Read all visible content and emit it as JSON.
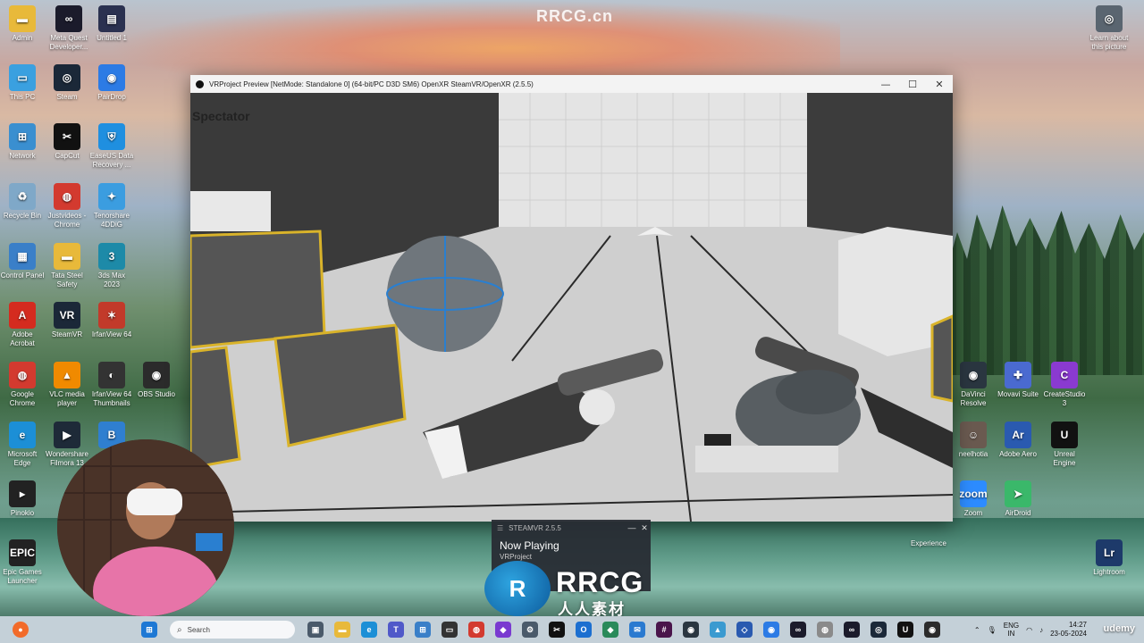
{
  "watermark": {
    "top": "RRCG.cn",
    "logo_big": "RRCG",
    "logo_small": "人人素材",
    "logo_mark": "R",
    "corner": "udemy"
  },
  "desktop_icons_left": [
    {
      "label": "Admin",
      "icon": "folder-icon",
      "color": "#e8b93a",
      "glyph": "▬"
    },
    {
      "label": "Meta Quest Developer...",
      "icon": "meta-icon",
      "color": "#1b1b2b",
      "glyph": "∞"
    },
    {
      "label": "Untitled 1",
      "icon": "document-icon",
      "color": "#2b3150",
      "glyph": "▤"
    },
    {
      "label": "This PC",
      "icon": "monitor-icon",
      "color": "#3aa0e0",
      "glyph": "▭"
    },
    {
      "label": "Steam",
      "icon": "steam-icon",
      "color": "#1b2838",
      "glyph": "◎"
    },
    {
      "label": "PairDrop",
      "icon": "pairdrop-icon",
      "color": "#2c7be5",
      "glyph": "◉"
    },
    {
      "label": "Network",
      "icon": "network-icon",
      "color": "#3a8fd0",
      "glyph": "⊞"
    },
    {
      "label": "CapCut",
      "icon": "capcut-icon",
      "color": "#111111",
      "glyph": "✂"
    },
    {
      "label": "EaseUS Data Recovery ...",
      "icon": "easeus-icon",
      "color": "#1f8fe0",
      "glyph": "⛨"
    },
    {
      "label": "Recycle Bin",
      "icon": "recycle-bin-icon",
      "color": "#7fa8c8",
      "glyph": "♻"
    },
    {
      "label": "Justvideos - Chrome",
      "icon": "chrome-icon",
      "color": "#d33a2f",
      "glyph": "◍"
    },
    {
      "label": "Tenorshare 4DDiG",
      "icon": "tenorshare-icon",
      "color": "#3b9de0",
      "glyph": "✦"
    },
    {
      "label": "Control Panel",
      "icon": "control-panel-icon",
      "color": "#3a7fc8",
      "glyph": "▦"
    },
    {
      "label": "Tata Steel Safety",
      "icon": "folder-icon",
      "color": "#e8b93a",
      "glyph": "▬"
    },
    {
      "label": "3ds Max 2023",
      "icon": "3dsmax-icon",
      "color": "#1d8aa8",
      "glyph": "3"
    },
    {
      "label": "Adobe Acrobat",
      "icon": "acrobat-icon",
      "color": "#d42b1f",
      "glyph": "A"
    },
    {
      "label": "SteamVR",
      "icon": "steamvr-icon",
      "color": "#1b2838",
      "glyph": "VR"
    },
    {
      "label": "IrfanView 64",
      "icon": "irfanview-icon",
      "color": "#c23a2a",
      "glyph": "✶"
    },
    {
      "label": "Google Chrome",
      "icon": "chrome-icon",
      "color": "#d33a2f",
      "glyph": "◍"
    },
    {
      "label": "VLC media player",
      "icon": "vlc-icon",
      "color": "#f08a00",
      "glyph": "▲"
    },
    {
      "label": "IrfanView 64 Thumbnails",
      "icon": "panda-icon",
      "color": "#333333",
      "glyph": "◐"
    },
    {
      "label": "OBS Studio",
      "icon": "obs-icon",
      "color": "#2b2b2b",
      "glyph": "◉"
    },
    {
      "label": "Microsoft Edge",
      "icon": "edge-icon",
      "color": "#1c8fd6",
      "glyph": "e"
    },
    {
      "label": "Wondershare Filmora 13",
      "icon": "filmora-icon",
      "color": "#1e2a38",
      "glyph": "▶"
    },
    {
      "label": "",
      "icon": "app-icon",
      "color": "#2f7fd0",
      "glyph": "B"
    },
    {
      "label": "Pinokio",
      "icon": "pinokio-icon",
      "color": "#222222",
      "glyph": "▸"
    },
    {
      "label": "Epic Games Launcher",
      "icon": "epic-icon",
      "color": "#222222",
      "glyph": "EPIC"
    }
  ],
  "desktop_icons_right": [
    {
      "label": "Learn about this picture",
      "icon": "camera-icon",
      "color": "#5a6570",
      "glyph": "◎"
    },
    {
      "label": "DaVinci Resolve",
      "icon": "davinci-icon",
      "color": "#2a3640",
      "glyph": "◉"
    },
    {
      "label": "Movavi Suite",
      "icon": "movavi-icon",
      "color": "#4a6ad0",
      "glyph": "✚"
    },
    {
      "label": "CreateStudio 3",
      "icon": "createstudio-icon",
      "color": "#8a3ad0",
      "glyph": "C"
    },
    {
      "label": "neelhotia",
      "icon": "user-icon",
      "color": "#6a5a50",
      "glyph": "☺"
    },
    {
      "label": "Adobe Aero",
      "icon": "aero-icon",
      "color": "#2a5ab0",
      "glyph": "Ar"
    },
    {
      "label": "Unreal Engine",
      "icon": "unreal-icon",
      "color": "#111111",
      "glyph": "U"
    },
    {
      "label": "Zoom",
      "icon": "zoom-icon",
      "color": "#2d8cff",
      "glyph": "zoom"
    },
    {
      "label": "AirDroid",
      "icon": "airdroid-icon",
      "color": "#3ab86a",
      "glyph": "➤"
    },
    {
      "label": "Experience",
      "icon": "experience-icon",
      "color": "#446655",
      "glyph": ""
    },
    {
      "label": "Lightroom",
      "icon": "lightroom-icon",
      "color": "#1d3a6a",
      "glyph": "Lr"
    }
  ],
  "vr_window": {
    "title": "VRProject Preview [NetMode: Standalone 0]  (64-bit/PC D3D SM6) OpenXR SteamVR/OpenXR (2.5.5)",
    "minimize": "—",
    "maximize": "☐",
    "close": "✕",
    "overlay_label": "Spectator"
  },
  "steamvr_notification": {
    "title": "STEAMVR 2.5.5",
    "minimize": "—",
    "close": "✕",
    "heading": "Now Playing",
    "project": "VRProject"
  },
  "taskbar": {
    "search_placeholder": "Search",
    "start_icon": "windows-start-icon",
    "lang_top": "ENG",
    "lang_bottom": "IN",
    "time": "14:27",
    "date": "23-05-2024",
    "apps": [
      {
        "icon": "task-view-icon",
        "color": "#4a5a6a",
        "glyph": "▣"
      },
      {
        "icon": "file-explorer-icon",
        "color": "#e8b93a",
        "glyph": "▬"
      },
      {
        "icon": "edge-icon",
        "color": "#1c8fd6",
        "glyph": "e"
      },
      {
        "icon": "teams-icon",
        "color": "#5059c9",
        "glyph": "T"
      },
      {
        "icon": "store-icon",
        "color": "#3a7fc8",
        "glyph": "⊞"
      },
      {
        "icon": "capture-icon",
        "color": "#333333",
        "glyph": "▭"
      },
      {
        "icon": "chrome-icon",
        "color": "#d33a2f",
        "glyph": "◍"
      },
      {
        "icon": "vs-icon",
        "color": "#7a3ad0",
        "glyph": "◆"
      },
      {
        "icon": "settings-icon",
        "color": "#4a5a6a",
        "glyph": "⚙"
      },
      {
        "icon": "capcut-icon",
        "color": "#111111",
        "glyph": "✂"
      },
      {
        "icon": "outlook-icon",
        "color": "#1c6fd0",
        "glyph": "O"
      },
      {
        "icon": "shield-icon",
        "color": "#2a8a5a",
        "glyph": "◆"
      },
      {
        "icon": "mail-icon",
        "color": "#2a7ad0",
        "glyph": "✉"
      },
      {
        "icon": "slack-icon",
        "color": "#4a154b",
        "glyph": "#"
      },
      {
        "icon": "davinci-icon",
        "color": "#2a3640",
        "glyph": "◉"
      },
      {
        "icon": "photos-icon",
        "color": "#3a9ad0",
        "glyph": "▲"
      },
      {
        "icon": "sketch-icon",
        "color": "#2a5ab0",
        "glyph": "◇"
      },
      {
        "icon": "pairdrop-icon",
        "color": "#2c7be5",
        "glyph": "◉"
      },
      {
        "icon": "meta-icon",
        "color": "#1b1b2b",
        "glyph": "∞"
      },
      {
        "icon": "chrome-alt-icon",
        "color": "#8a8a8a",
        "glyph": "◍"
      },
      {
        "icon": "meta-quest-icon",
        "color": "#1b1b2b",
        "glyph": "∞"
      },
      {
        "icon": "steam-icon",
        "color": "#1b2838",
        "glyph": "◎"
      },
      {
        "icon": "unreal-icon",
        "color": "#111111",
        "glyph": "U"
      },
      {
        "icon": "obs-icon",
        "color": "#2b2b2b",
        "glyph": "◉"
      }
    ]
  }
}
